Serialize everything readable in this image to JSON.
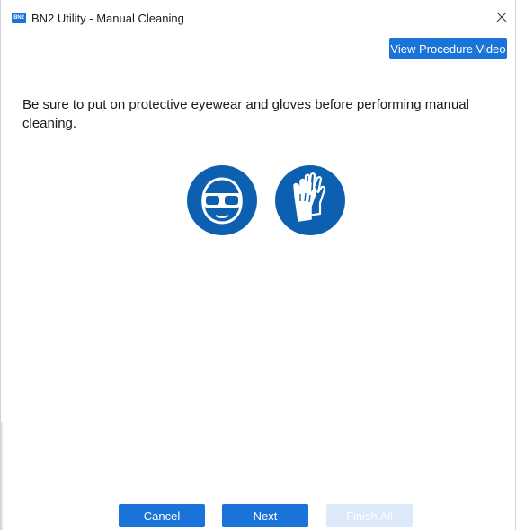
{
  "window": {
    "title": "BN2 Utility - Manual Cleaning",
    "app_icon_text": "BN2",
    "close_glyph": "✕"
  },
  "toolbar": {
    "view_video_label": "View Procedure Video"
  },
  "main": {
    "instruction": "Be sure to put on protective eyewear and gloves before performing manual cleaning.",
    "safety_icons": [
      {
        "name": "safety-goggles-icon"
      },
      {
        "name": "protective-gloves-icon"
      }
    ]
  },
  "footer": {
    "cancel_label": "Cancel",
    "next_label": "Next",
    "finish_label": "Finish All"
  },
  "colors": {
    "accent": "#1a73d9",
    "safety_blue": "#0d5fb0",
    "disabled": "#dce9f8"
  }
}
